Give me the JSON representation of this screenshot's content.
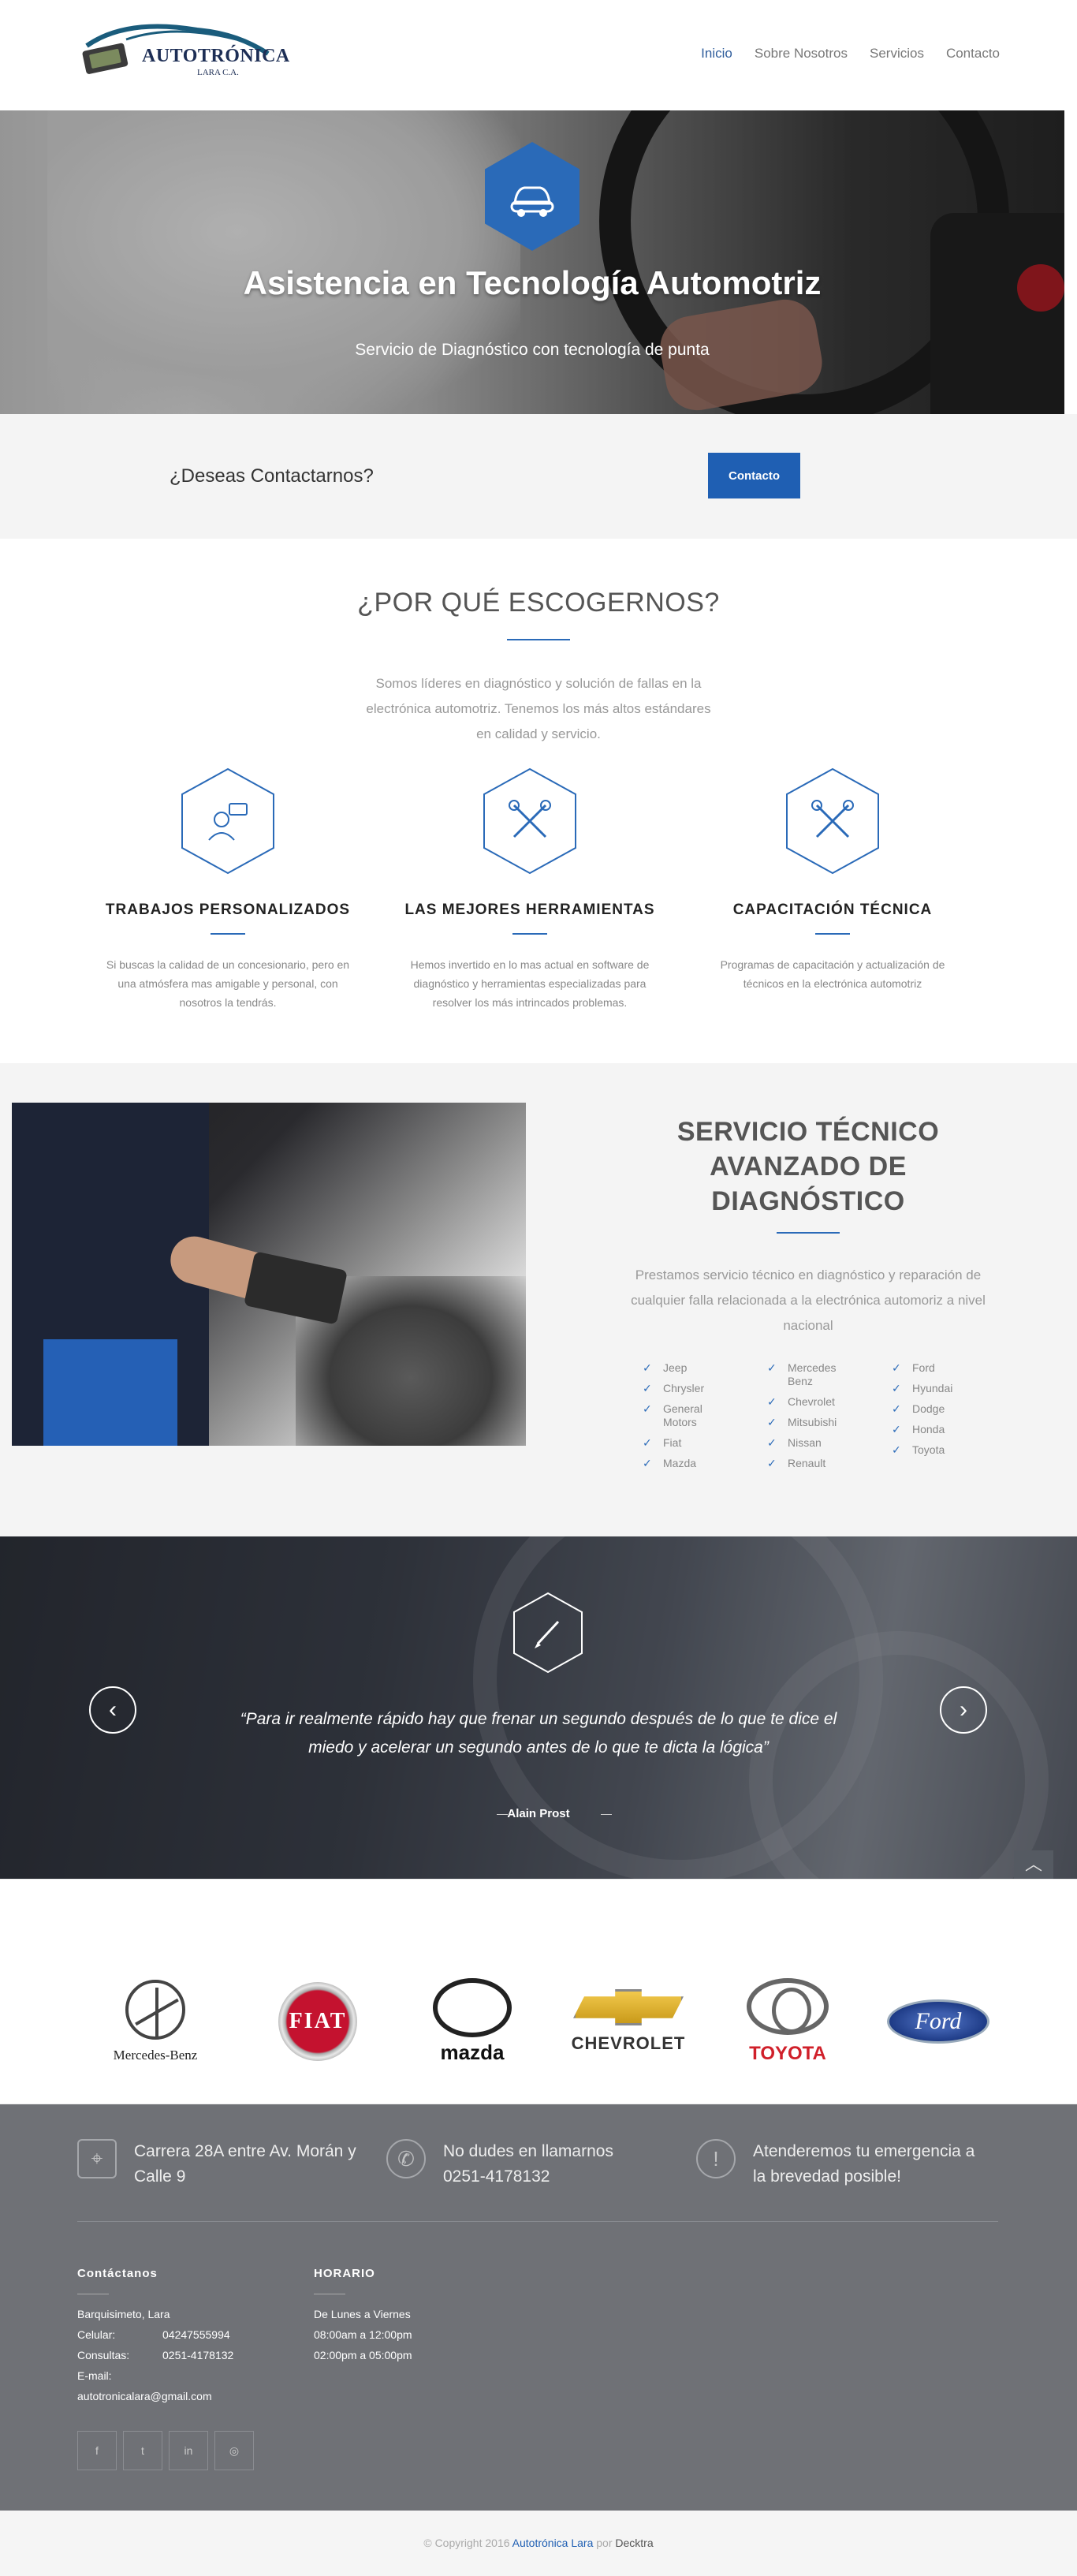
{
  "header": {
    "logo_text": "AUTOTRÓNICA",
    "logo_sub": "LARA C.A.",
    "nav": [
      {
        "label": "Inicio"
      },
      {
        "label": "Sobre Nosotros"
      },
      {
        "label": "Servicios"
      },
      {
        "label": "Contacto"
      }
    ]
  },
  "hero": {
    "icon": "car-icon",
    "title": "Asistencia en Tecnología Automotriz",
    "subtitle": "Servicio de Diagnóstico con tecnología de punta"
  },
  "cta": {
    "text": "¿Deseas Contactarnos?",
    "button": "Contacto"
  },
  "why": {
    "title": "¿POR QUÉ ESCOGERNOS?",
    "intro": "Somos líderes en diagnóstico y solución de fallas en la electrónica automotriz. Tenemos los más altos estándares en calidad y servicio.",
    "features": [
      {
        "icon": "user-chat-icon",
        "title": "TRABAJOS PERSONALIZADOS",
        "text": "Si buscas la calidad de un concesionario, pero en una atmósfera mas amigable y personal, con nosotros la tendrás."
      },
      {
        "icon": "tools-icon",
        "title": "LAS MEJORES HERRAMIENTAS",
        "text": "Hemos invertido en lo mas actual en software de diagnóstico y herramientas especializadas para resolver los más intrincados problemas."
      },
      {
        "icon": "tools-icon",
        "title": "CAPACITACIÓN TÉCNICA",
        "text": "Programas de capacitación y actualización de técnicos en la electrónica automotriz"
      }
    ]
  },
  "service": {
    "title": "SERVICIO TÉCNICO AVANZADO DE DIAGNÓSTICO",
    "text": "Prestamos servicio técnico en diagnóstico y reparación de cualquier falla relacionada a la electrónica automoriz a nivel nacional",
    "brands_col1": [
      "Jeep",
      "Chrysler",
      "General Motors",
      "Fiat",
      "Mazda"
    ],
    "brands_col2": [
      "Mercedes Benz",
      "Chevrolet",
      "Mitsubishi",
      "Nissan",
      "Renault"
    ],
    "brands_col3": [
      "Ford",
      "Hyundai",
      "Dodge",
      "Honda",
      "Toyota"
    ]
  },
  "quote": {
    "icon": "pencil-icon",
    "text": "“Para ir realmente rápido hay que frenar un segundo después de lo que te dice el miedo y acelerar un segundo antes de lo que te dicta la lógica”",
    "author": "Alain Prost",
    "prev": "‹",
    "next": "›",
    "to_top": "︿"
  },
  "logos": {
    "mercedes": "Mercedes-Benz",
    "fiat": "FIAT",
    "mazda": "mazda",
    "chevrolet": "CHEVROLET",
    "toyota": "TOYOTA",
    "ford": "Ford"
  },
  "footer": {
    "info": [
      {
        "icon": "map-icon",
        "text": "Carrera 28A entre Av. Morán y Calle 9"
      },
      {
        "icon": "phone-icon",
        "text": "No dudes en llamarnos 0251-4178132"
      },
      {
        "icon": "alert-icon",
        "text": "Atenderemos tu emergencia a la brevedad posible!"
      }
    ],
    "contact_title": "Contáctanos",
    "city": "Barquisimeto, Lara",
    "cel_label": "Celular:",
    "cel": "04247555994",
    "cons_label": "Consultas:",
    "cons": "0251-4178132",
    "email_label": "E-mail:",
    "email": "autotronicalara@gmail.com",
    "hours_title": "HORARIO",
    "hours": [
      "De Lunes a Viernes",
      "08:00am a 12:00pm",
      "02:00pm a 05:00pm"
    ],
    "socials": [
      "f",
      "t",
      "in",
      "◎"
    ]
  },
  "copyright": {
    "prefix": "© Copyright 2016",
    "company": "Autotrónica Lara",
    "by": "por",
    "dev": "Decktra"
  }
}
